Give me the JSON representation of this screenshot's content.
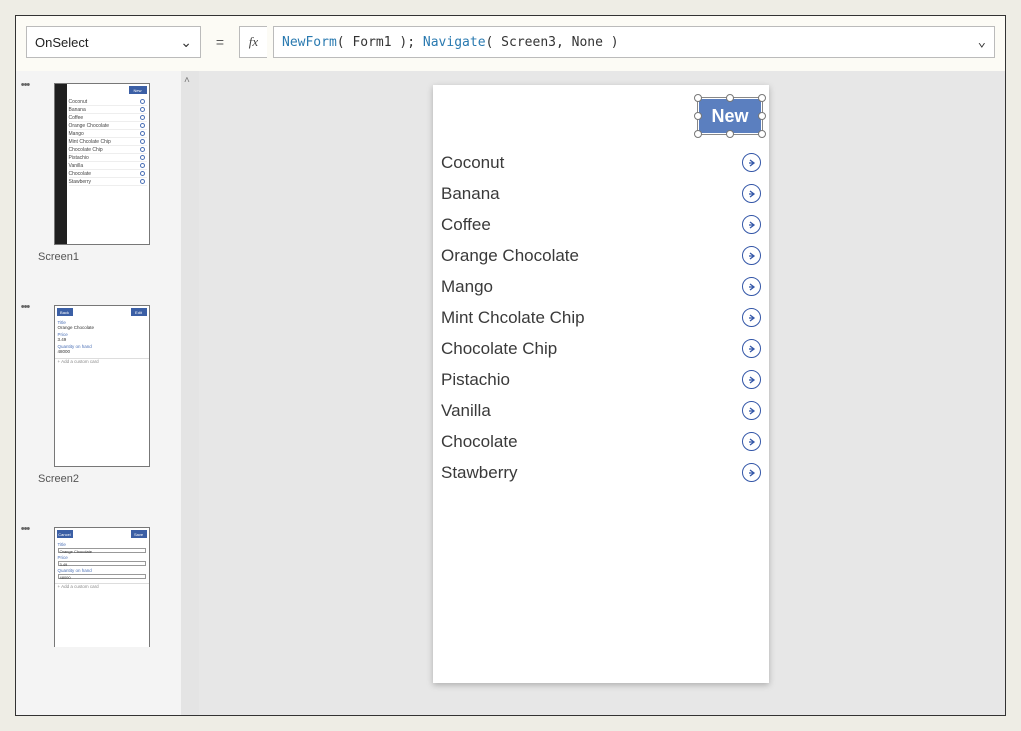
{
  "formula_bar": {
    "property": "OnSelect",
    "fx": "fx",
    "eq": "=",
    "expr_kw1": "NewForm",
    "expr_arg1": " Form1 ",
    "expr_sep": "; ",
    "expr_kw2": "Navigate",
    "expr_arg2": " Screen3, None "
  },
  "thumbs": {
    "s1_label": "Screen1",
    "s2_label": "Screen2",
    "new_label": "New",
    "back_label": "Back",
    "edit_label": "Edit",
    "cancel_label": "Cancel",
    "save_label": "Save",
    "title_lbl": "Title",
    "price_lbl": "Price",
    "qty_lbl": "Quantity on hand",
    "addcard": "+  Add a custom card",
    "t2_title": "Orange Chocolate",
    "t2_price": "3.49",
    "t2_qty": "48000",
    "items": [
      "Coconut",
      "Banana",
      "Coffee",
      "Orange Chocolate",
      "Mango",
      "Mint Chcolate Chip",
      "Chocolate Chip",
      "Pistachio",
      "Vanilla",
      "Chocolate",
      "Stawberry"
    ]
  },
  "canvas": {
    "new_label": "New",
    "items": [
      "Coconut",
      "Banana",
      "Coffee",
      "Orange Chocolate",
      "Mango",
      "Mint Chcolate Chip",
      "Chocolate Chip",
      "Pistachio",
      "Vanilla",
      "Chocolate",
      "Stawberry"
    ]
  }
}
